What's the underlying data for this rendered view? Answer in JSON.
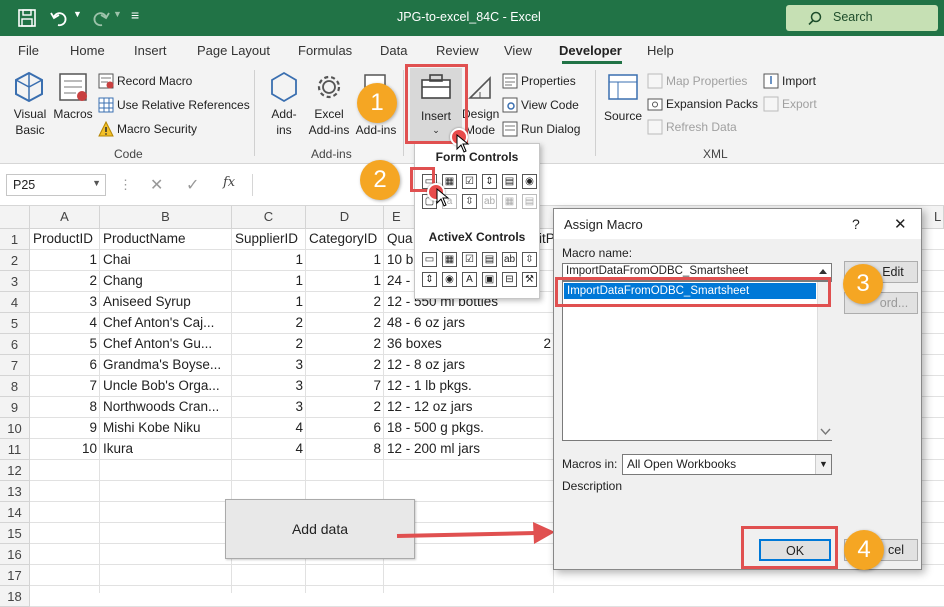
{
  "titlebar": {
    "doc_title": "JPG-to-excel_84C  -  Excel",
    "search_label": "Search"
  },
  "tabs": [
    "File",
    "Home",
    "Insert",
    "Page Layout",
    "Formulas",
    "Data",
    "Review",
    "View",
    "Developer",
    "Help"
  ],
  "ribbon": {
    "code": {
      "visual_basic": [
        "Visual",
        "Basic"
      ],
      "macros": "Macros",
      "record_macro": "Record Macro",
      "use_relative": "Use Relative References",
      "macro_security": "Macro Security",
      "group": "Code"
    },
    "addins": {
      "add_ins": [
        "Add-",
        "ins"
      ],
      "excel_add_ins": [
        "Excel",
        "Add-ins"
      ],
      "com_add_ins": [
        "C",
        "Add-ins"
      ],
      "group": "Add-ins"
    },
    "controls": {
      "insert": "Insert",
      "design_mode": [
        "Design",
        "Mode"
      ],
      "properties": "Properties",
      "view_code": "View Code",
      "run_dialog": "Run Dialog"
    },
    "xml": {
      "source": "Source",
      "map_properties": "Map Properties",
      "expansion_packs": "Expansion Packs",
      "refresh_data": "Refresh Data",
      "import": "Import",
      "export": "Export",
      "group": "XML"
    }
  },
  "formula_bar": {
    "name_box": "P25",
    "fx": "fx"
  },
  "form_controls_menu": {
    "form_title": "Form Controls",
    "activex_title": "ActiveX Controls"
  },
  "sheet": {
    "columns": [
      "A",
      "B",
      "C",
      "D"
    ],
    "col_e_partial": "E",
    "col_l_partial": "L",
    "row_numbers": [
      "1",
      "2",
      "3",
      "4",
      "5",
      "6",
      "7",
      "8",
      "9",
      "10",
      "11",
      "12",
      "13",
      "14",
      "15",
      "16",
      "17",
      "18"
    ],
    "headers": [
      "ProductID",
      "ProductName",
      "SupplierID",
      "CategoryID",
      "Qua"
    ],
    "header_f_partial": "itP",
    "rows": [
      [
        "1",
        "Chai",
        "1",
        "1",
        "10 b"
      ],
      [
        "2",
        "Chang",
        "1",
        "1",
        "24 -"
      ],
      [
        "3",
        "Aniseed Syrup",
        "1",
        "2",
        "12 - 550 ml bottles"
      ],
      [
        "4",
        "Chef Anton's Caj...",
        "2",
        "2",
        "48 - 6 oz jars"
      ],
      [
        "5",
        "Chef Anton's Gu...",
        "2",
        "2",
        "36 boxes"
      ],
      [
        "6",
        "Grandma's Boyse...",
        "3",
        "2",
        "12 - 8 oz jars"
      ],
      [
        "7",
        "Uncle Bob's Orga...",
        "3",
        "7",
        "12 - 1 lb pkgs."
      ],
      [
        "8",
        "Northwoods Cran...",
        "3",
        "2",
        "12 - 12 oz jars"
      ],
      [
        "9",
        "Mishi Kobe Niku",
        "4",
        "6",
        "18 - 500 g pkgs."
      ],
      [
        "10",
        "Ikura",
        "4",
        "8",
        "12 - 200 ml jars"
      ]
    ],
    "row6_f_partial": "2",
    "button_label": "Add data"
  },
  "dialog": {
    "title": "Assign Macro",
    "help": "?",
    "close": "✕",
    "macro_name_label": "Macro name:",
    "macro_name_value": "ImportDataFromODBC_Smartsheet",
    "macro_list_item": "ImportDataFromODBC_Smartsheet",
    "edit": "Edit",
    "record": "ord...",
    "macros_in_label": "Macros in:",
    "macros_in_value": "All Open Workbooks",
    "description_label": "Description",
    "ok": "OK",
    "cancel": "cel"
  },
  "badges": [
    "1",
    "2",
    "3",
    "4"
  ],
  "colors": {
    "excel_green": "#217346",
    "highlight": "#e05050",
    "badge": "#f5a623",
    "selection": "#0078d7"
  }
}
